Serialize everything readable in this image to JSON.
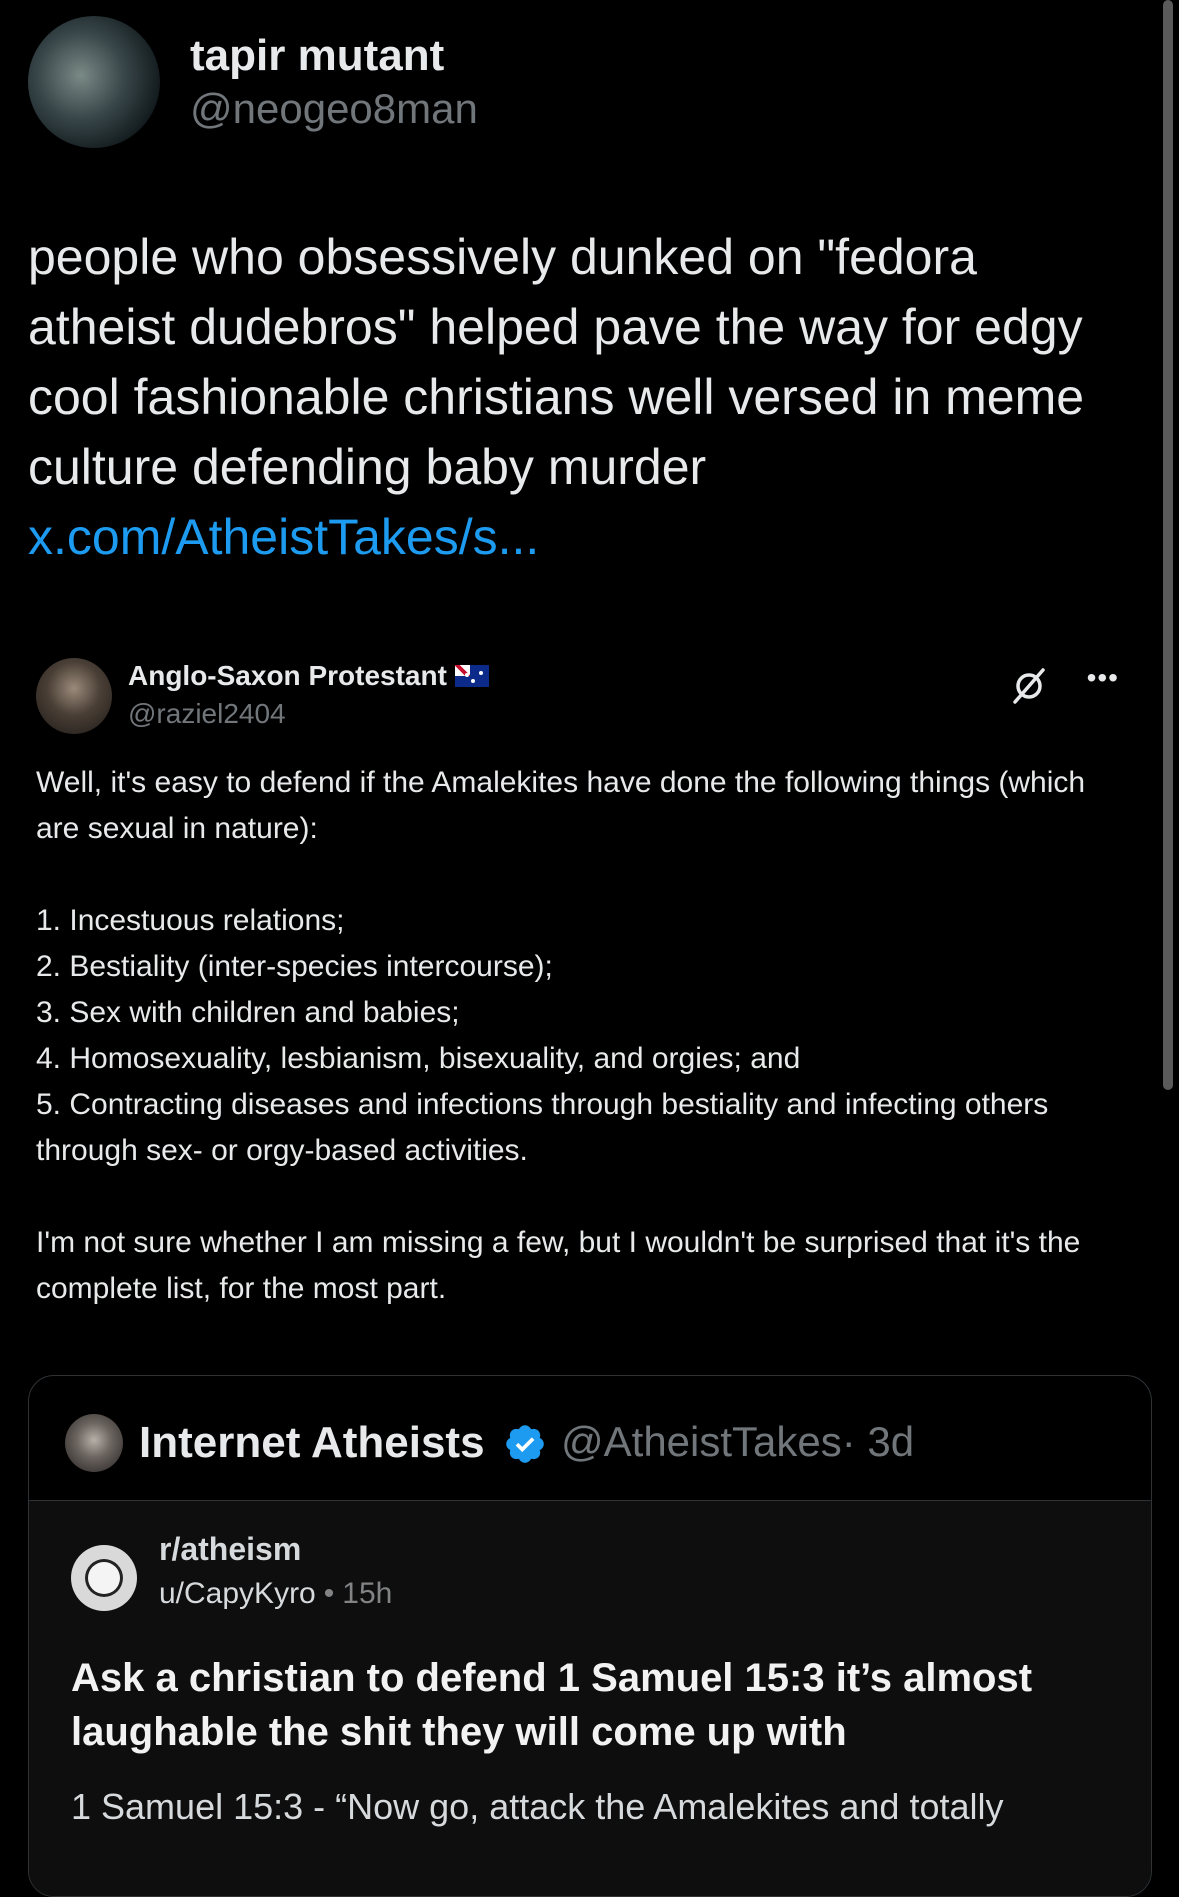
{
  "post": {
    "author": {
      "display_name": "tapir mutant",
      "handle": "@neogeo8man"
    },
    "text": "people who obsessively dunked on \"fedora atheist dudebros\" helped pave the way for edgy cool fashionable christians well versed in meme culture defending baby murder ",
    "link_text": "x.com/AtheistTakes/s..."
  },
  "quoted_post": {
    "author": {
      "display_name": "Anglo-Saxon Protestant",
      "handle": "@raziel2404"
    },
    "paragraphs": [
      "Well, it's easy to defend if the Amalekites have done the following things (which are sexual in nature):"
    ],
    "list_items": [
      "1. Incestuous relations;",
      "2. Bestiality (inter-species intercourse);",
      "3. Sex with children and babies;",
      "4. Homosexuality, lesbianism, bisexuality, and orgies; and",
      "5. Contracting diseases and infections through bestiality and infecting others through sex- or orgy-based activities."
    ],
    "closing": "I'm not sure whether I am missing a few, but I wouldn't be surprised that it's the complete list, for the most part."
  },
  "embedded_card": {
    "author": {
      "display_name": "Internet Atheists",
      "handle": "@AtheistTakes",
      "time": "· 3d"
    },
    "reddit": {
      "subreddit": "r/atheism",
      "user": "u/CapyKyro",
      "separator": "•",
      "time": "15h",
      "title": "Ask a christian to defend 1 Samuel 15:3 it’s almost laughable the shit they will come up with",
      "body": "1 Samuel 15:3 - “Now go, attack the Amalekites and totally"
    }
  },
  "icons": {
    "verified": "verified-badge-icon",
    "grok": "grok-icon",
    "more": "more-options-icon"
  },
  "colors": {
    "background": "#000000",
    "text": "#e7e9ea",
    "secondary": "#71767b",
    "link": "#1d9bf0",
    "verified": "#1d9bf0"
  }
}
